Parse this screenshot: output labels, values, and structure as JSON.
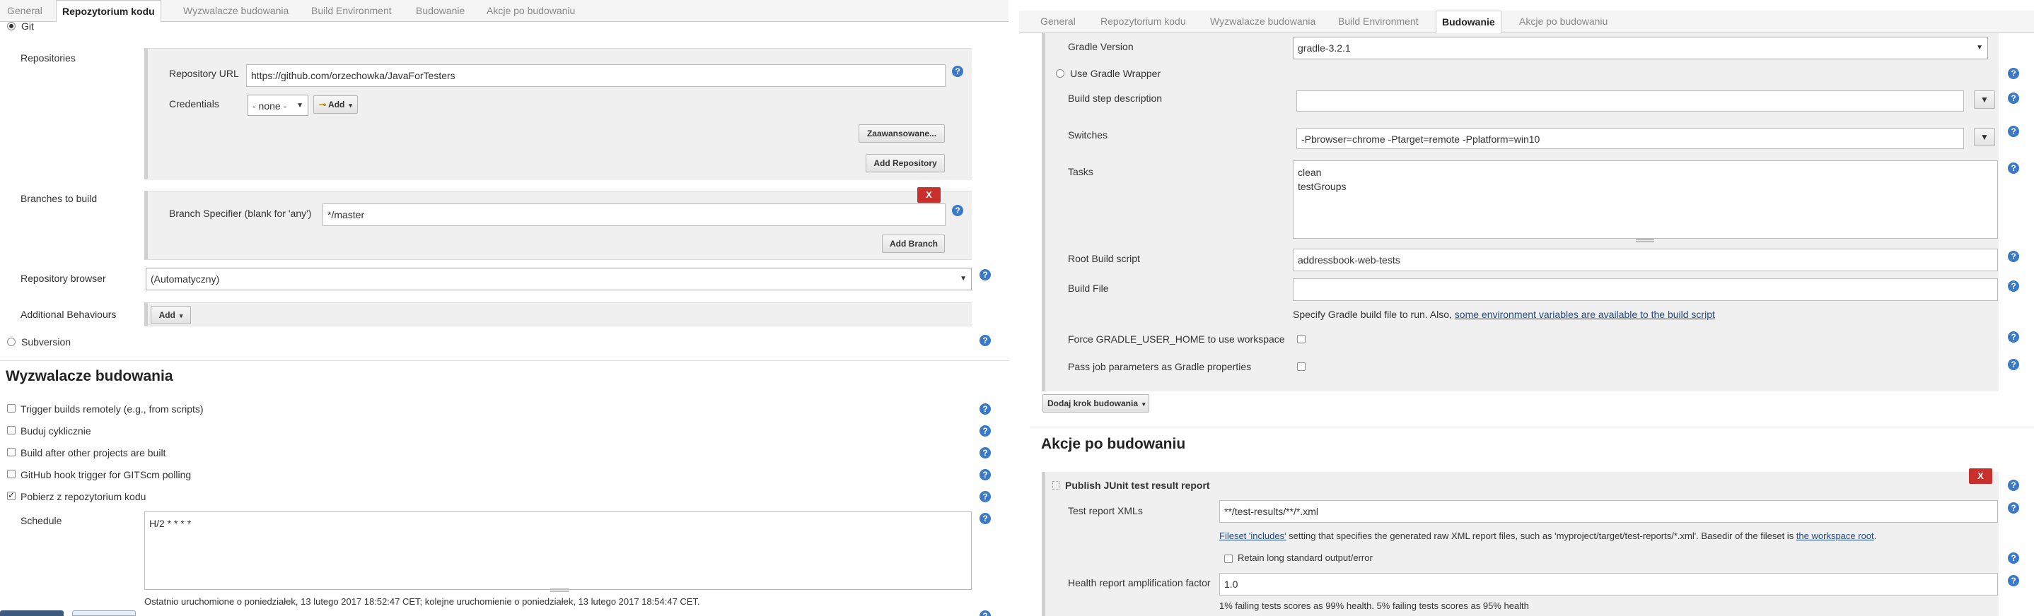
{
  "left": {
    "tabs": [
      "General",
      "Repozytorium kodu",
      "Wyzwalacze budowania",
      "Build Environment",
      "Budowanie",
      "Akcje po budowaniu"
    ],
    "active_tab": "Repozytorium kodu",
    "git_label": "Git",
    "repositories_label": "Repositories",
    "repo_url_label": "Repository URL",
    "repo_url_value": "https://github.com/orzechowka/JavaForTesters",
    "credentials_label": "Credentials",
    "credentials_value": "- none -",
    "add_cred_label": "Add",
    "advanced_label": "Zaawansowane...",
    "add_repo_label": "Add Repository",
    "branches_label": "Branches to build",
    "delete_label": "X",
    "branch_spec_label": "Branch Specifier (blank for 'any')",
    "branch_spec_value": "*/master",
    "add_branch_label": "Add Branch",
    "repo_browser_label": "Repository browser",
    "repo_browser_value": "(Automatyczny)",
    "add_behaviours_label": "Additional Behaviours",
    "add_label": "Add",
    "subversion_label": "Subversion",
    "triggers_heading": "Wyzwalacze budowania",
    "triggers": [
      {
        "label": "Trigger builds remotely (e.g., from scripts)",
        "checked": false
      },
      {
        "label": "Buduj cyklicznie",
        "checked": false
      },
      {
        "label": "Build after other projects are built",
        "checked": false
      },
      {
        "label": "GitHub hook trigger for GITScm polling",
        "checked": false
      },
      {
        "label": "Pobierz z repozytorium kodu",
        "checked": true
      }
    ],
    "schedule_label": "Schedule",
    "schedule_value": "H/2 * * * *",
    "schedule_info": "Ostatnio uruchomione o poniedziałek, 13 lutego 2017 18:52:47 CET; kolejne uruchomienie o poniedziałek, 13 lutego 2017 18:54:47 CET."
  },
  "right": {
    "tabs": [
      "General",
      "Repozytorium kodu",
      "Wyzwalacze budowania",
      "Build Environment",
      "Budowanie",
      "Akcje po budowaniu"
    ],
    "active_tab": "Budowanie",
    "gradle_version_label": "Gradle Version",
    "gradle_version_value": "gradle-3.2.1",
    "use_wrapper_label": "Use Gradle Wrapper",
    "step_desc_label": "Build step description",
    "switches_label": "Switches",
    "switches_value": "-Pbrowser=chrome -Ptarget=remote -Pplatform=win10",
    "tasks_label": "Tasks",
    "tasks_value": "clean\ntestGroups",
    "root_script_label": "Root Build script",
    "root_script_value": "addressbook-web-tests",
    "build_file_label": "Build File",
    "build_file_help_prefix": "Specify Gradle build file to run. Also, ",
    "build_file_help_link": "some environment variables are available to the build script",
    "force_home_label": "Force GRADLE_USER_HOME to use workspace",
    "pass_params_label": "Pass job parameters as Gradle properties",
    "add_step_label": "Dodaj krok budowania",
    "post_heading": "Akcje po budowaniu",
    "delete_label": "X",
    "junit_title": "Publish JUnit test result report",
    "test_xml_label": "Test report XMLs",
    "test_xml_value": "**/test-results/**/*.xml",
    "fileset_link": "Fileset 'includes'",
    "fileset_text": " setting that specifies the generated raw XML report files, such as 'myproject/target/test-reports/*.xml'. Basedir of the fileset is ",
    "workspace_link": "the workspace root",
    "workspace_end": ".",
    "retain_label": "Retain long standard output/error",
    "health_label": "Health report amplification factor",
    "health_value": "1.0",
    "health_help": "1% failing tests scores as 99% health. 5% failing tests scores as 95% health"
  },
  "help_glyph": "?"
}
